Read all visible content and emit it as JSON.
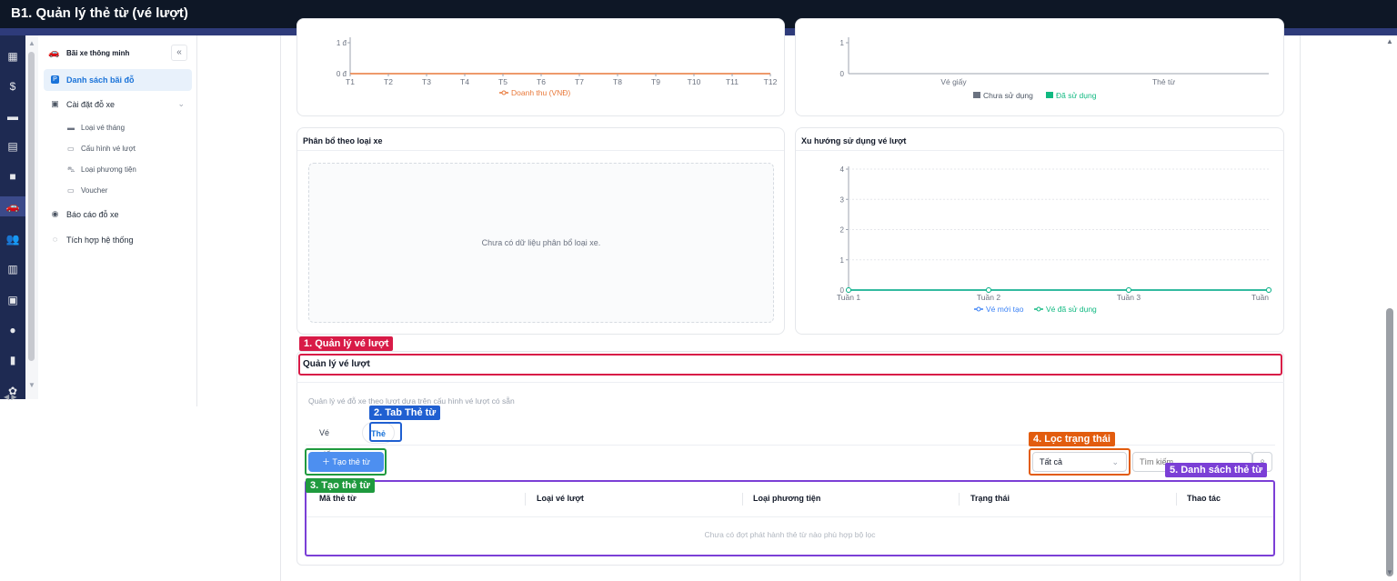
{
  "window": {
    "title": "B1. Quản lý thẻ từ (vé lượt)"
  },
  "sidebar": {
    "header": "Bãi xe thông minh",
    "collapse_icon": "«",
    "items": [
      {
        "label": "Danh sách bãi đỗ",
        "active": true
      },
      {
        "label": "Cài đặt đỗ xe"
      },
      {
        "label": "Báo cáo đỗ xe"
      },
      {
        "label": "Tích hợp hệ thống"
      }
    ],
    "subitems": [
      {
        "label": "Loại vé tháng",
        "icon": "wallet-icon"
      },
      {
        "label": "Cấu hình vé lượt",
        "icon": "ticket-icon"
      },
      {
        "label": "Loại phương tiện",
        "icon": "car-icon"
      },
      {
        "label": "Voucher",
        "icon": "voucher-icon"
      }
    ]
  },
  "charts": {
    "revenue": {
      "type": "line",
      "categories": [
        "T1",
        "T2",
        "T3",
        "T4",
        "T5",
        "T6",
        "T7",
        "T8",
        "T9",
        "T10",
        "T11",
        "T12"
      ],
      "series": [
        {
          "name": "Doanh thu (VNĐ)",
          "values": [
            0,
            0,
            0,
            0,
            0,
            0,
            0,
            0,
            0,
            0,
            0,
            0
          ],
          "color": "#e8793a"
        }
      ],
      "ytick_labels": [
        "0 đ",
        "1 đ"
      ]
    },
    "usage": {
      "type": "bar",
      "categories": [
        "Vé giấy",
        "Thẻ từ"
      ],
      "ytick_labels": [
        "0",
        "1"
      ],
      "legend": [
        {
          "name": "Chưa sử dụng",
          "color": "#6b7280"
        },
        {
          "name": "Đã sử dụng",
          "color": "#10b981"
        }
      ]
    },
    "distribution": {
      "title": "Phân bổ theo loại xe",
      "empty_text": "Chưa có dữ liệu phân bổ loại xe."
    },
    "trend": {
      "title": "Xu hướng sử dụng vé lượt",
      "type": "line",
      "categories": [
        "Tuần 1",
        "Tuần 2",
        "Tuần 3",
        "Tuần"
      ],
      "yticks": [
        0,
        1,
        2,
        3,
        4
      ],
      "series": [
        {
          "name": "Vé mới tạo",
          "values": [
            0,
            0,
            0,
            0
          ],
          "color": "#3b82f6"
        },
        {
          "name": "Vé đã sử dụng",
          "values": [
            0,
            0,
            0,
            0
          ],
          "color": "#10b981"
        }
      ]
    }
  },
  "section": {
    "title": "Quản lý vé lượt",
    "description": "Quản lý vé đỗ xe theo lượt dựa trên cấu hình vé lượt có sẵn",
    "tabs": [
      "Vé giấy",
      "Thẻ từ"
    ],
    "active_tab": "Thẻ từ",
    "create_button": "Tạo thẻ từ",
    "status_filter": "Tất cả",
    "search_placeholder": "Tìm kiếm",
    "columns": [
      "Mã thẻ từ",
      "Loại vé lượt",
      "Loại phương tiện",
      "Trạng thái",
      "Thao tác"
    ],
    "empty_text": "Chưa có đợt phát hành thẻ từ nào phù hợp bộ lọc"
  },
  "annotations": [
    {
      "label": "1. Quản lý vé lượt",
      "color": "#d81b47"
    },
    {
      "label": "2. Tab Thẻ từ",
      "color": "#1f5fd1"
    },
    {
      "label": "3. Tạo thẻ từ",
      "color": "#1f9a3e"
    },
    {
      "label": "4. Lọc trạng thái",
      "color": "#e25c0e"
    },
    {
      "label": "5. Danh sách thẻ từ",
      "color": "#7b3fd6"
    }
  ]
}
